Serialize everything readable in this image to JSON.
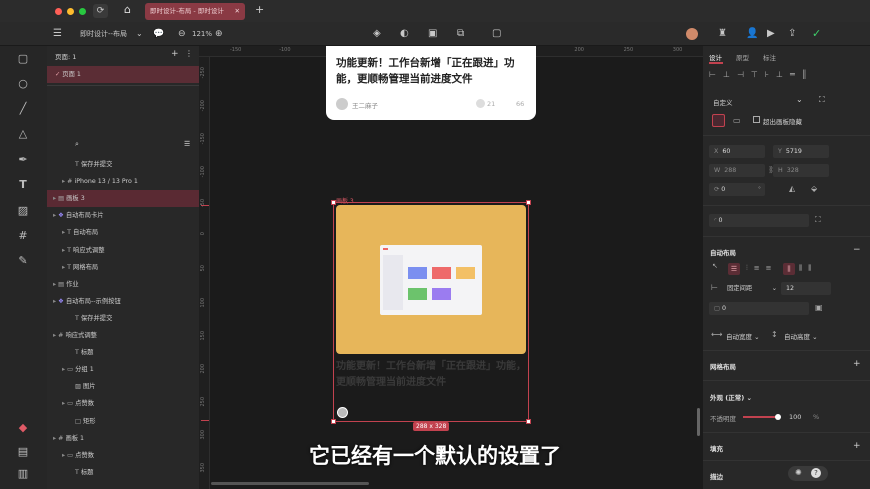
{
  "tabbar": {
    "tab_title": "即时设计-布局 - 即时设计",
    "new_tab": "+"
  },
  "toolbar": {
    "file_name": "即时设计--布局",
    "zoom": "121%"
  },
  "layers": {
    "page_count": "页面: 1",
    "page_name": "页面 1",
    "items": [
      {
        "label": "保存并提交",
        "icon": "text-icon",
        "indent": 2
      },
      {
        "label": "iPhone 13 / 13 Pro 1",
        "icon": "frame-icon",
        "indent": 1
      },
      {
        "label": "画板 3",
        "icon": "board-icon",
        "indent": 0,
        "selected": true
      },
      {
        "label": "自动布局卡片",
        "icon": "component-icon",
        "indent": 0
      },
      {
        "label": "自动布局",
        "icon": "text-icon",
        "indent": 1
      },
      {
        "label": "响应式调整",
        "icon": "text-icon",
        "indent": 1
      },
      {
        "label": "网格布局",
        "icon": "text-icon",
        "indent": 1
      },
      {
        "label": "作业",
        "icon": "board-icon",
        "indent": 0
      },
      {
        "label": "自动布局--示例按钮",
        "icon": "component-icon",
        "indent": 0
      },
      {
        "label": "保存并提交",
        "icon": "text-icon",
        "indent": 2
      },
      {
        "label": "响应式调整",
        "icon": "frame-icon",
        "indent": 0
      },
      {
        "label": "标题",
        "icon": "text-icon",
        "indent": 2
      },
      {
        "label": "分组 1",
        "icon": "group-icon",
        "indent": 1
      },
      {
        "label": "图片",
        "icon": "image-icon",
        "indent": 2
      },
      {
        "label": "点赞数",
        "icon": "group-icon",
        "indent": 1
      },
      {
        "label": "矩形",
        "icon": "rect-icon",
        "indent": 2
      },
      {
        "label": "画板 1",
        "icon": "frame-icon",
        "indent": 0
      },
      {
        "label": "点赞数",
        "icon": "group-icon",
        "indent": 1
      },
      {
        "label": "标题",
        "icon": "text-icon",
        "indent": 2
      }
    ]
  },
  "canvas": {
    "top_ticks": [
      "-150",
      "-100",
      "-50",
      "0",
      "50",
      "100",
      "150",
      "200",
      "250",
      "300",
      "350"
    ],
    "left_ticks": [
      "-250",
      "-200",
      "-150",
      "-100",
      "-50",
      "0",
      "50",
      "100",
      "150",
      "200",
      "250",
      "300",
      "350",
      "400"
    ],
    "card_title": "功能更新！工作台新增「正在跟进」功能，更顺畅管理当前进度文件",
    "card_author": "王二麻子",
    "card_views": "21",
    "card_likes": "66",
    "frame_label": "画板 3",
    "frame_size": "288 x 328",
    "ghost_text": "功能更新！工作台新增「正在跟进」功能，更顺畅管理当前进度文件"
  },
  "panel": {
    "tabs": [
      "设计",
      "原型",
      "标注"
    ],
    "preset": "自定义",
    "clip_label": "超出画板隐藏",
    "x_label": "X",
    "x": "60",
    "y_label": "Y",
    "y": "5719",
    "w_label": "W",
    "w": "288",
    "h_label": "H",
    "h": "328",
    "rotation": "0",
    "rotation_unit": "°",
    "radius": "0",
    "auto_layout_title": "自动布局",
    "spacing_mode": "固定间距",
    "spacing": "12",
    "padding": "0",
    "width_mode": "自动宽度",
    "height_mode": "自动高度",
    "grid_title": "网格布局",
    "appearance_title": "外观 (正常)",
    "opacity_label": "不透明度",
    "opacity": "100",
    "opacity_unit": "%",
    "fill_title": "填充",
    "stroke_title": "描边",
    "accent": "#c2424f"
  },
  "subtitle": "它已经有一个默认的设置了"
}
